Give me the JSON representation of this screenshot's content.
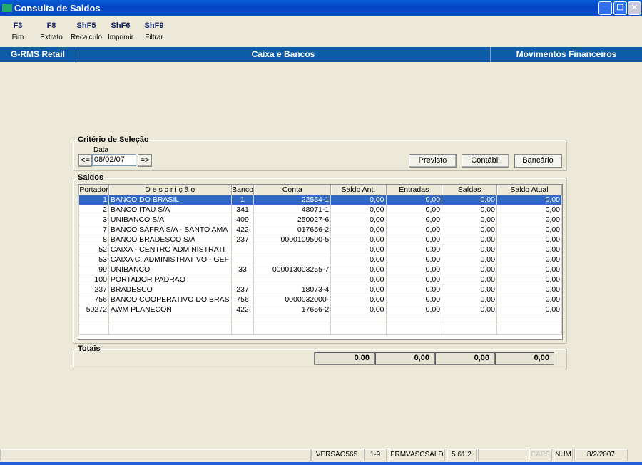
{
  "window": {
    "title": "Consulta de Saldos",
    "icon_text": "RMS"
  },
  "toolbar": [
    {
      "key": "F3",
      "label": "Fim"
    },
    {
      "key": "F8",
      "label": "Extrato"
    },
    {
      "key": "ShF5",
      "label": "Recalculo"
    },
    {
      "key": "ShF6",
      "label": "Imprimir"
    },
    {
      "key": "ShF9",
      "label": "Filtrar"
    }
  ],
  "band": {
    "app": "G-RMS Retail",
    "module": "Caixa e Bancos",
    "function": "Movimentos Financeiros"
  },
  "criteria": {
    "legend": "Critério de Seleção",
    "date_label": "Data",
    "date_value": "08/02/07",
    "prev": "<=",
    "next": "=>",
    "previsto": "Previsto",
    "contabil": "Contábil",
    "bancario": "Bancário"
  },
  "saldos": {
    "legend": "Saldos",
    "columns": [
      "Portador",
      "D e s c r i ç ã o",
      "Banco",
      "Conta",
      "Saldo Ant.",
      "Entradas",
      "Saídas",
      "Saldo Atual"
    ],
    "rows": [
      [
        "1",
        "BANCO DO BRASIL",
        "1",
        "22554-1",
        "0,00",
        "0,00",
        "0,00",
        "0,00"
      ],
      [
        "2",
        "BANCO ITAU S/A",
        "341",
        "48071-1",
        "0,00",
        "0,00",
        "0,00",
        "0,00"
      ],
      [
        "3",
        "UNIBANCO S/A",
        "409",
        "250027-6",
        "0,00",
        "0,00",
        "0,00",
        "0,00"
      ],
      [
        "7",
        "BANCO SAFRA S/A - SANTO AMA",
        "422",
        "017656-2",
        "0,00",
        "0,00",
        "0,00",
        "0,00"
      ],
      [
        "8",
        "BANCO BRADESCO S/A",
        "237",
        "0000109500-5",
        "0,00",
        "0,00",
        "0,00",
        "0,00"
      ],
      [
        "52",
        "CAIXA - CENTRO ADMINISTRATI",
        "",
        "",
        "0,00",
        "0,00",
        "0,00",
        "0,00"
      ],
      [
        "53",
        "CAIXA C. ADMINISTRATIVO - GEF",
        "",
        "",
        "0,00",
        "0,00",
        "0,00",
        "0,00"
      ],
      [
        "99",
        "UNIBANCO",
        "33",
        "000013003255-7",
        "0,00",
        "0,00",
        "0,00",
        "0,00"
      ],
      [
        "100",
        "PORTADOR PADRAO",
        "",
        "",
        "0,00",
        "0,00",
        "0,00",
        "0,00"
      ],
      [
        "237",
        "BRADESCO",
        "237",
        "18073-4",
        "0,00",
        "0,00",
        "0,00",
        "0,00"
      ],
      [
        "756",
        "BANCO COOPERATIVO DO BRAS",
        "756",
        "0000032000-",
        "0,00",
        "0,00",
        "0,00",
        "0,00"
      ],
      [
        "50272",
        "AWM PLANECON",
        "422",
        "17656-2",
        "0,00",
        "0,00",
        "0,00",
        "0,00"
      ]
    ]
  },
  "totais": {
    "legend": "Totais",
    "values": [
      "0,00",
      "0,00",
      "0,00",
      "0,00"
    ]
  },
  "status": [
    "",
    "VERSAO565",
    "1-9",
    "FRMVASCSALD",
    "5.61.2",
    "",
    "CAPS",
    "NUM",
    "8/2/2007"
  ]
}
